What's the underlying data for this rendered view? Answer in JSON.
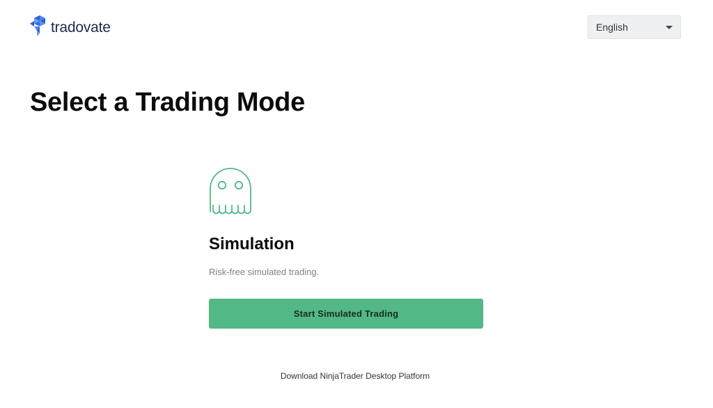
{
  "header": {
    "logo_text": "tradovate",
    "language": {
      "selected": "English"
    }
  },
  "main": {
    "title": "Select a Trading Mode",
    "mode": {
      "icon": "ghost-icon",
      "title": "Simulation",
      "description": "Risk-free simulated trading.",
      "button_label": "Start Simulated Trading"
    }
  },
  "footer": {
    "download_link": "Download NinjaTrader Desktop Platform"
  },
  "colors": {
    "accent_green": "#52b885",
    "logo_blue": "#3b6fe0",
    "logo_text": "#1c2b4a"
  }
}
